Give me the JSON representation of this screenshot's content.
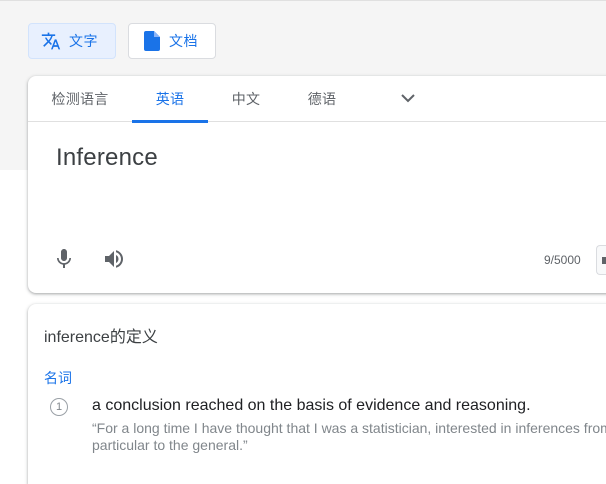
{
  "modes": {
    "text_label": "文字",
    "doc_label": "文档"
  },
  "source": {
    "tabs": [
      {
        "label": "检测语言"
      },
      {
        "label": "英语"
      },
      {
        "label": "中文"
      },
      {
        "label": "德语"
      }
    ],
    "active_tab": "英语",
    "text": "Inference",
    "char_count": "9/5000"
  },
  "definition": {
    "title": "inference的定义",
    "part_of_speech": "名词",
    "entries": [
      {
        "number": "1",
        "text": "a conclusion reached on the basis of evidence and reasoning.",
        "example": "“For a long time I have thought that I was a statistician, interested in inferences from the particular to the general.”"
      }
    ]
  },
  "colors": {
    "accent": "#1a73e8",
    "text": "#3c4043",
    "secondary": "#5f6368",
    "muted": "#80868b"
  },
  "icons": [
    "translate-icon",
    "document-icon",
    "chevron-down-icon",
    "microphone-icon",
    "speaker-icon"
  ]
}
